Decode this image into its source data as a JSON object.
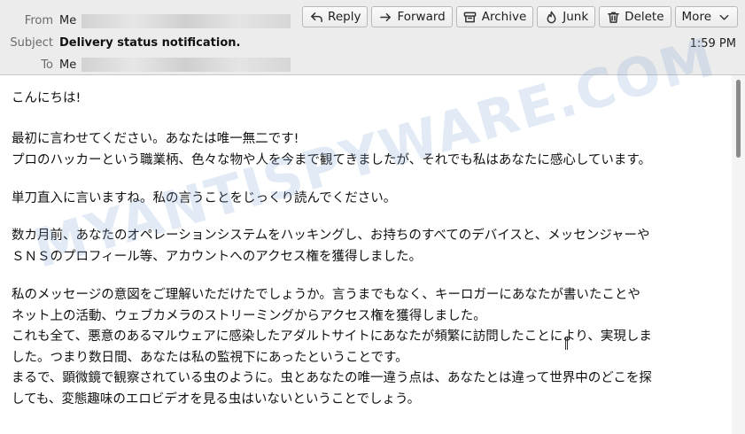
{
  "header": {
    "from_label": "From",
    "from_value": "Me",
    "subject_label": "Subject",
    "subject_value": "Delivery status notification.",
    "to_label": "To",
    "to_value": "Me",
    "time": "1:59 PM"
  },
  "toolbar": {
    "reply": "Reply",
    "forward": "Forward",
    "archive": "Archive",
    "junk": "Junk",
    "delete": "Delete",
    "more": "More"
  },
  "message": {
    "greeting": "こんにちは!",
    "p2": [
      "最初に言わせてください。あなたは唯一無二です!",
      "プロのハッカーという職業柄、色々な物や人を今まで観てきましたが、それでも私はあなたに感心しています。"
    ],
    "p3": [
      "単刀直入に言いますね。私の言うことをじっくり読んでください。"
    ],
    "p4": [
      "数カ月前、あなたのオペレーションシステムをハッキングし、お持ちのすべてのデバイスと、メッセンジャーや",
      "ＳＮＳのプロフィール等、アカウントへのアクセス権を獲得しました。"
    ],
    "p5": [
      "私のメッセージの意図をご理解いただけたでしょうか。言うまでもなく、キーロガーにあなたが書いたことや",
      "ネット上の活動、ウェブカメラのストリーミングからアクセス権を獲得しました。",
      "これも全て、悪意のあるマルウェアに感染したアダルトサイトにあなたが頻繁に訪問したことにより、実現しま",
      "した。つまり数日間、あなたは私の監視下にあったということです。",
      "まるで、顕微鏡で観察されている虫のように。虫とあなたの唯一違う点は、あなたとは違って世界中のどこを探",
      "しても、変態趣味のエロビデオを見る虫はいないということでしょう。"
    ]
  },
  "watermark": "MYANTISPYWARE.COM"
}
